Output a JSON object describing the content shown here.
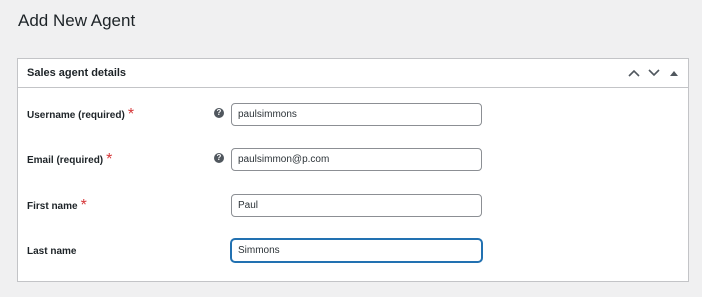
{
  "page": {
    "title": "Add New Agent"
  },
  "metabox": {
    "title": "Sales agent details",
    "controls": [
      {
        "name": "move-up-button",
        "icon": "chevron-up-icon"
      },
      {
        "name": "move-down-button",
        "icon": "chevron-down-icon"
      },
      {
        "name": "toggle-panel-button",
        "icon": "triangle-up-icon"
      }
    ]
  },
  "form": {
    "required_marker": "*",
    "help_glyph": "?",
    "username": {
      "label": "Username (required)",
      "required": true,
      "value": "paulsimmons",
      "has_help": true
    },
    "email": {
      "label": "Email (required)",
      "required": true,
      "value": "paulsimmon@p.com",
      "has_help": true
    },
    "first_name": {
      "label": "First name",
      "required": true,
      "value": "Paul"
    },
    "last_name": {
      "label": "Last name",
      "required": false,
      "value": "Simmons",
      "focused": true
    }
  },
  "colors": {
    "background": "#f0f0f1",
    "border": "#c3c4c7",
    "required": "#d63638",
    "focus": "#2271b1"
  }
}
